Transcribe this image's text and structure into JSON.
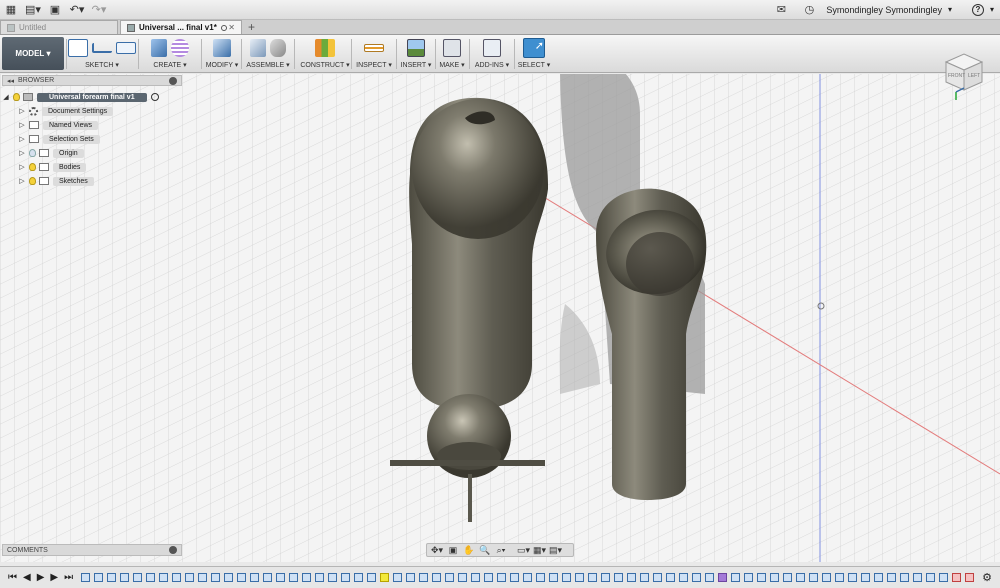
{
  "titlebar": {
    "user_name": "Symondingley Symondingley",
    "help_label": "?"
  },
  "tabs": [
    {
      "label": "Untitled",
      "active": false
    },
    {
      "label": "Universal ... final v1*",
      "active": true
    }
  ],
  "toolbar": {
    "workspace_label": "MODEL",
    "groups": [
      {
        "label": "SKETCH ▾"
      },
      {
        "label": "CREATE ▾"
      },
      {
        "label": "MODIFY ▾"
      },
      {
        "label": "ASSEMBLE ▾"
      },
      {
        "label": "CONSTRUCT ▾"
      },
      {
        "label": "INSPECT ▾"
      },
      {
        "label": "INSERT ▾"
      },
      {
        "label": "MAKE ▾"
      },
      {
        "label": "ADD-INS ▾"
      },
      {
        "label": "SELECT ▾"
      }
    ]
  },
  "browser": {
    "title": "BROWSER",
    "root_label": "Universal forearm final v1",
    "items": [
      {
        "label": "Document Settings",
        "icon": "gear-icon"
      },
      {
        "label": "Named Views",
        "icon": "folder-icon"
      },
      {
        "label": "Selection Sets",
        "icon": "folder-icon"
      },
      {
        "label": "Origin",
        "icon": "folder-icon"
      },
      {
        "label": "Bodies",
        "icon": "folder-icon"
      },
      {
        "label": "Sketches",
        "icon": "folder-icon"
      }
    ]
  },
  "comments": {
    "title": "COMMENTS"
  },
  "viewcube": {
    "faces": [
      "FRONT",
      "LEFT"
    ]
  },
  "colors": {
    "accent": "#3a6ea8",
    "highlight": "#f3e93a",
    "model": "#6b6b5f"
  }
}
